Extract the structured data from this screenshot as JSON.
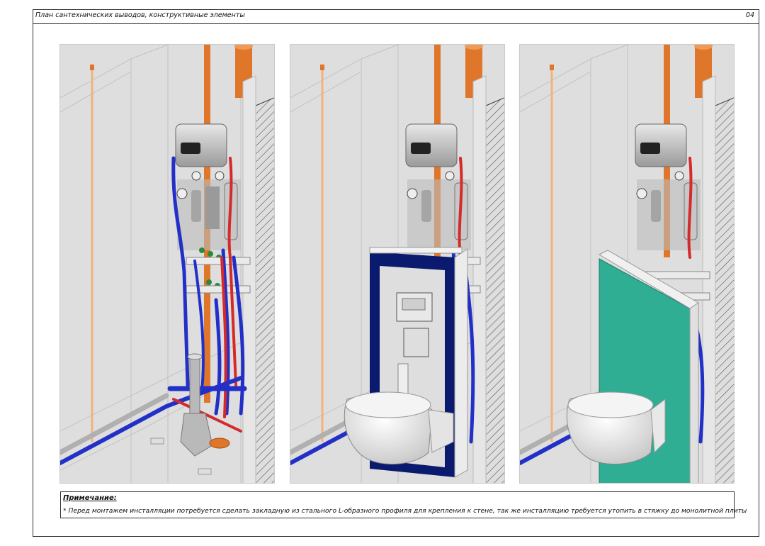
{
  "header": {
    "title": "План сантехнических выводов, конструктивные элементы",
    "page_number": "04"
  },
  "panels": [
    {
      "stage": "pipes-and-manifold"
    },
    {
      "stage": "installation-frame"
    },
    {
      "stage": "moisture-resistant-panel"
    }
  ],
  "colors": {
    "hot_pipe": "#d42a2a",
    "cold_pipe": "#2330c8",
    "sewer_pipe": "#e0762a",
    "frame": "#0a1a6e",
    "panel": "#2fae94",
    "background": "#dedede"
  },
  "note": {
    "title": "Примечание:",
    "text": "* Перед монтажем инсталляции потребуется сделать закладную из стального L-образного профиля для крепления к стене, так же инсталляцию требуется утопить в стяжку до монолитной плиты"
  }
}
